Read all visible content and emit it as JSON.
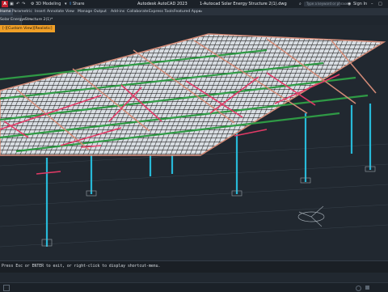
{
  "window": {
    "app_title": "Autodesk AutoCAD 2023",
    "file_title": "1-Autocad Solar Energy Structure 2(1).dwg",
    "search_placeholder": "Type a keyword or phrase",
    "sign_in": "Sign In",
    "workspace": "3D Modeling",
    "share_label": "Share"
  },
  "ribbon": {
    "tabs": [
      "Home",
      "Parametric",
      "Insert",
      "Annotate",
      "View",
      "Manage",
      "Output",
      "Add-ins",
      "Collaborate",
      "Express Tools",
      "Featured Apps"
    ],
    "active_tab": "Home"
  },
  "file_tabs": {
    "active_label": "Solar Energy Structure 2(1)*"
  },
  "viewport": {
    "label": "[-][Custom View][Realistic]"
  },
  "command_line": {
    "prompt": "Press Esc or ENTER to exit, or right-click to display shortcut-menu."
  },
  "colors": {
    "background": "#212830",
    "panel_grid": "#1c1c1c",
    "panel_frame": "#d48b77",
    "green_purlin": "#2f9a45",
    "red_brace": "#e23a66",
    "column": "#27b9d8",
    "accent": "#f1a027"
  }
}
